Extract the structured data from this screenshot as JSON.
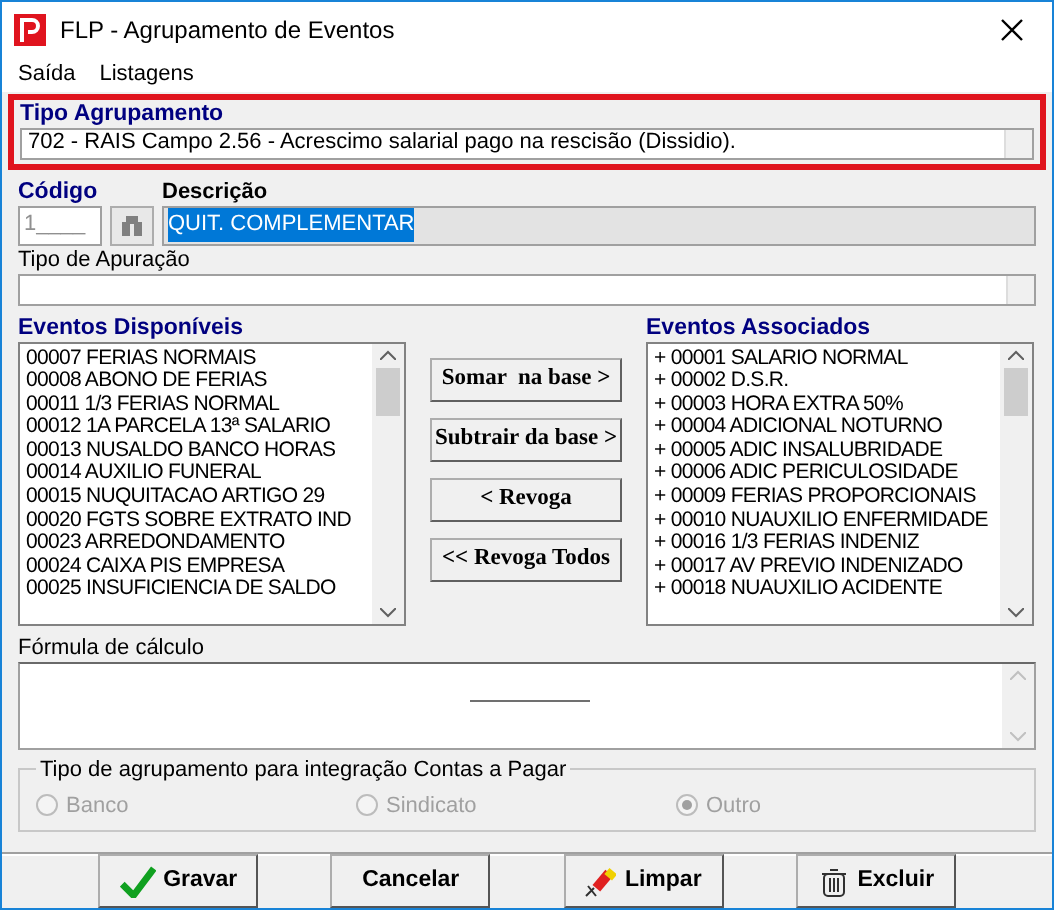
{
  "window": {
    "title": "FLP - Agrupamento de Eventos"
  },
  "menu": [
    {
      "label": "Saída"
    },
    {
      "label": "Listagens"
    }
  ],
  "tipo_agrupamento": {
    "label": "Tipo Agrupamento",
    "value": "702 - RAIS Campo 2.56 - Acrescimo salarial pago na rescisão (Dissidio).",
    "highlighted": true
  },
  "codigo": {
    "label": "Código",
    "value": "1____"
  },
  "descricao": {
    "label": "Descrição",
    "value": "QUIT. COMPLEMENTAR",
    "selected": true
  },
  "tipo_apuracao": {
    "label": "Tipo de Apuração"
  },
  "eventos_disponiveis": {
    "title": "Eventos Disponíveis",
    "items": [
      "00007 FERIAS NORMAIS",
      "00008 ABONO DE FERIAS",
      "00011 1/3 FERIAS NORMAL",
      "00012 1A PARCELA 13ª SALARIO",
      "00013 NUSALDO BANCO HORAS",
      "00014 AUXILIO FUNERAL",
      "00015 NUQUITACAO ARTIGO 29",
      "00020 FGTS SOBRE EXTRATO IND",
      "00023 ARREDONDAMENTO",
      "00024 CAIXA PIS EMPRESA",
      "00025 INSUFICIENCIA DE SALDO"
    ]
  },
  "actions": [
    "Somar  na base >",
    "Subtrair da base >",
    "< Revoga",
    "<< Revoga Todos"
  ],
  "eventos_associados": {
    "title": "Eventos Associados",
    "items": [
      "+ 00001 SALARIO NORMAL",
      "+ 00002 D.S.R.",
      "+ 00003 HORA EXTRA 50%",
      "+ 00004 ADICIONAL NOTURNO",
      "+ 00005 ADIC INSALUBRIDADE",
      "+ 00006 ADIC PERICULOSIDADE",
      "+ 00009 FERIAS PROPORCIONAIS",
      "+ 00010 NUAUXILIO ENFERMIDADE",
      "+ 00016 1/3 FERIAS INDENIZ",
      "+ 00017 AV PREVIO INDENIZADO",
      "+ 00018 NUAUXILIO ACIDENTE"
    ]
  },
  "formula": {
    "label": "Fórmula de cálculo"
  },
  "integracao": {
    "title": "Tipo de agrupamento para integração Contas a Pagar",
    "disabled": true,
    "options": [
      {
        "label": "Banco",
        "selected": false
      },
      {
        "label": "Sindicato",
        "selected": false
      },
      {
        "label": "Outro",
        "selected": true
      }
    ]
  },
  "buttons": [
    {
      "label": "Gravar",
      "kind": "check"
    },
    {
      "label": "Cancelar",
      "kind": "none"
    },
    {
      "label": "Limpar",
      "kind": "eraser"
    },
    {
      "label": "Excluir",
      "kind": "trash"
    }
  ]
}
